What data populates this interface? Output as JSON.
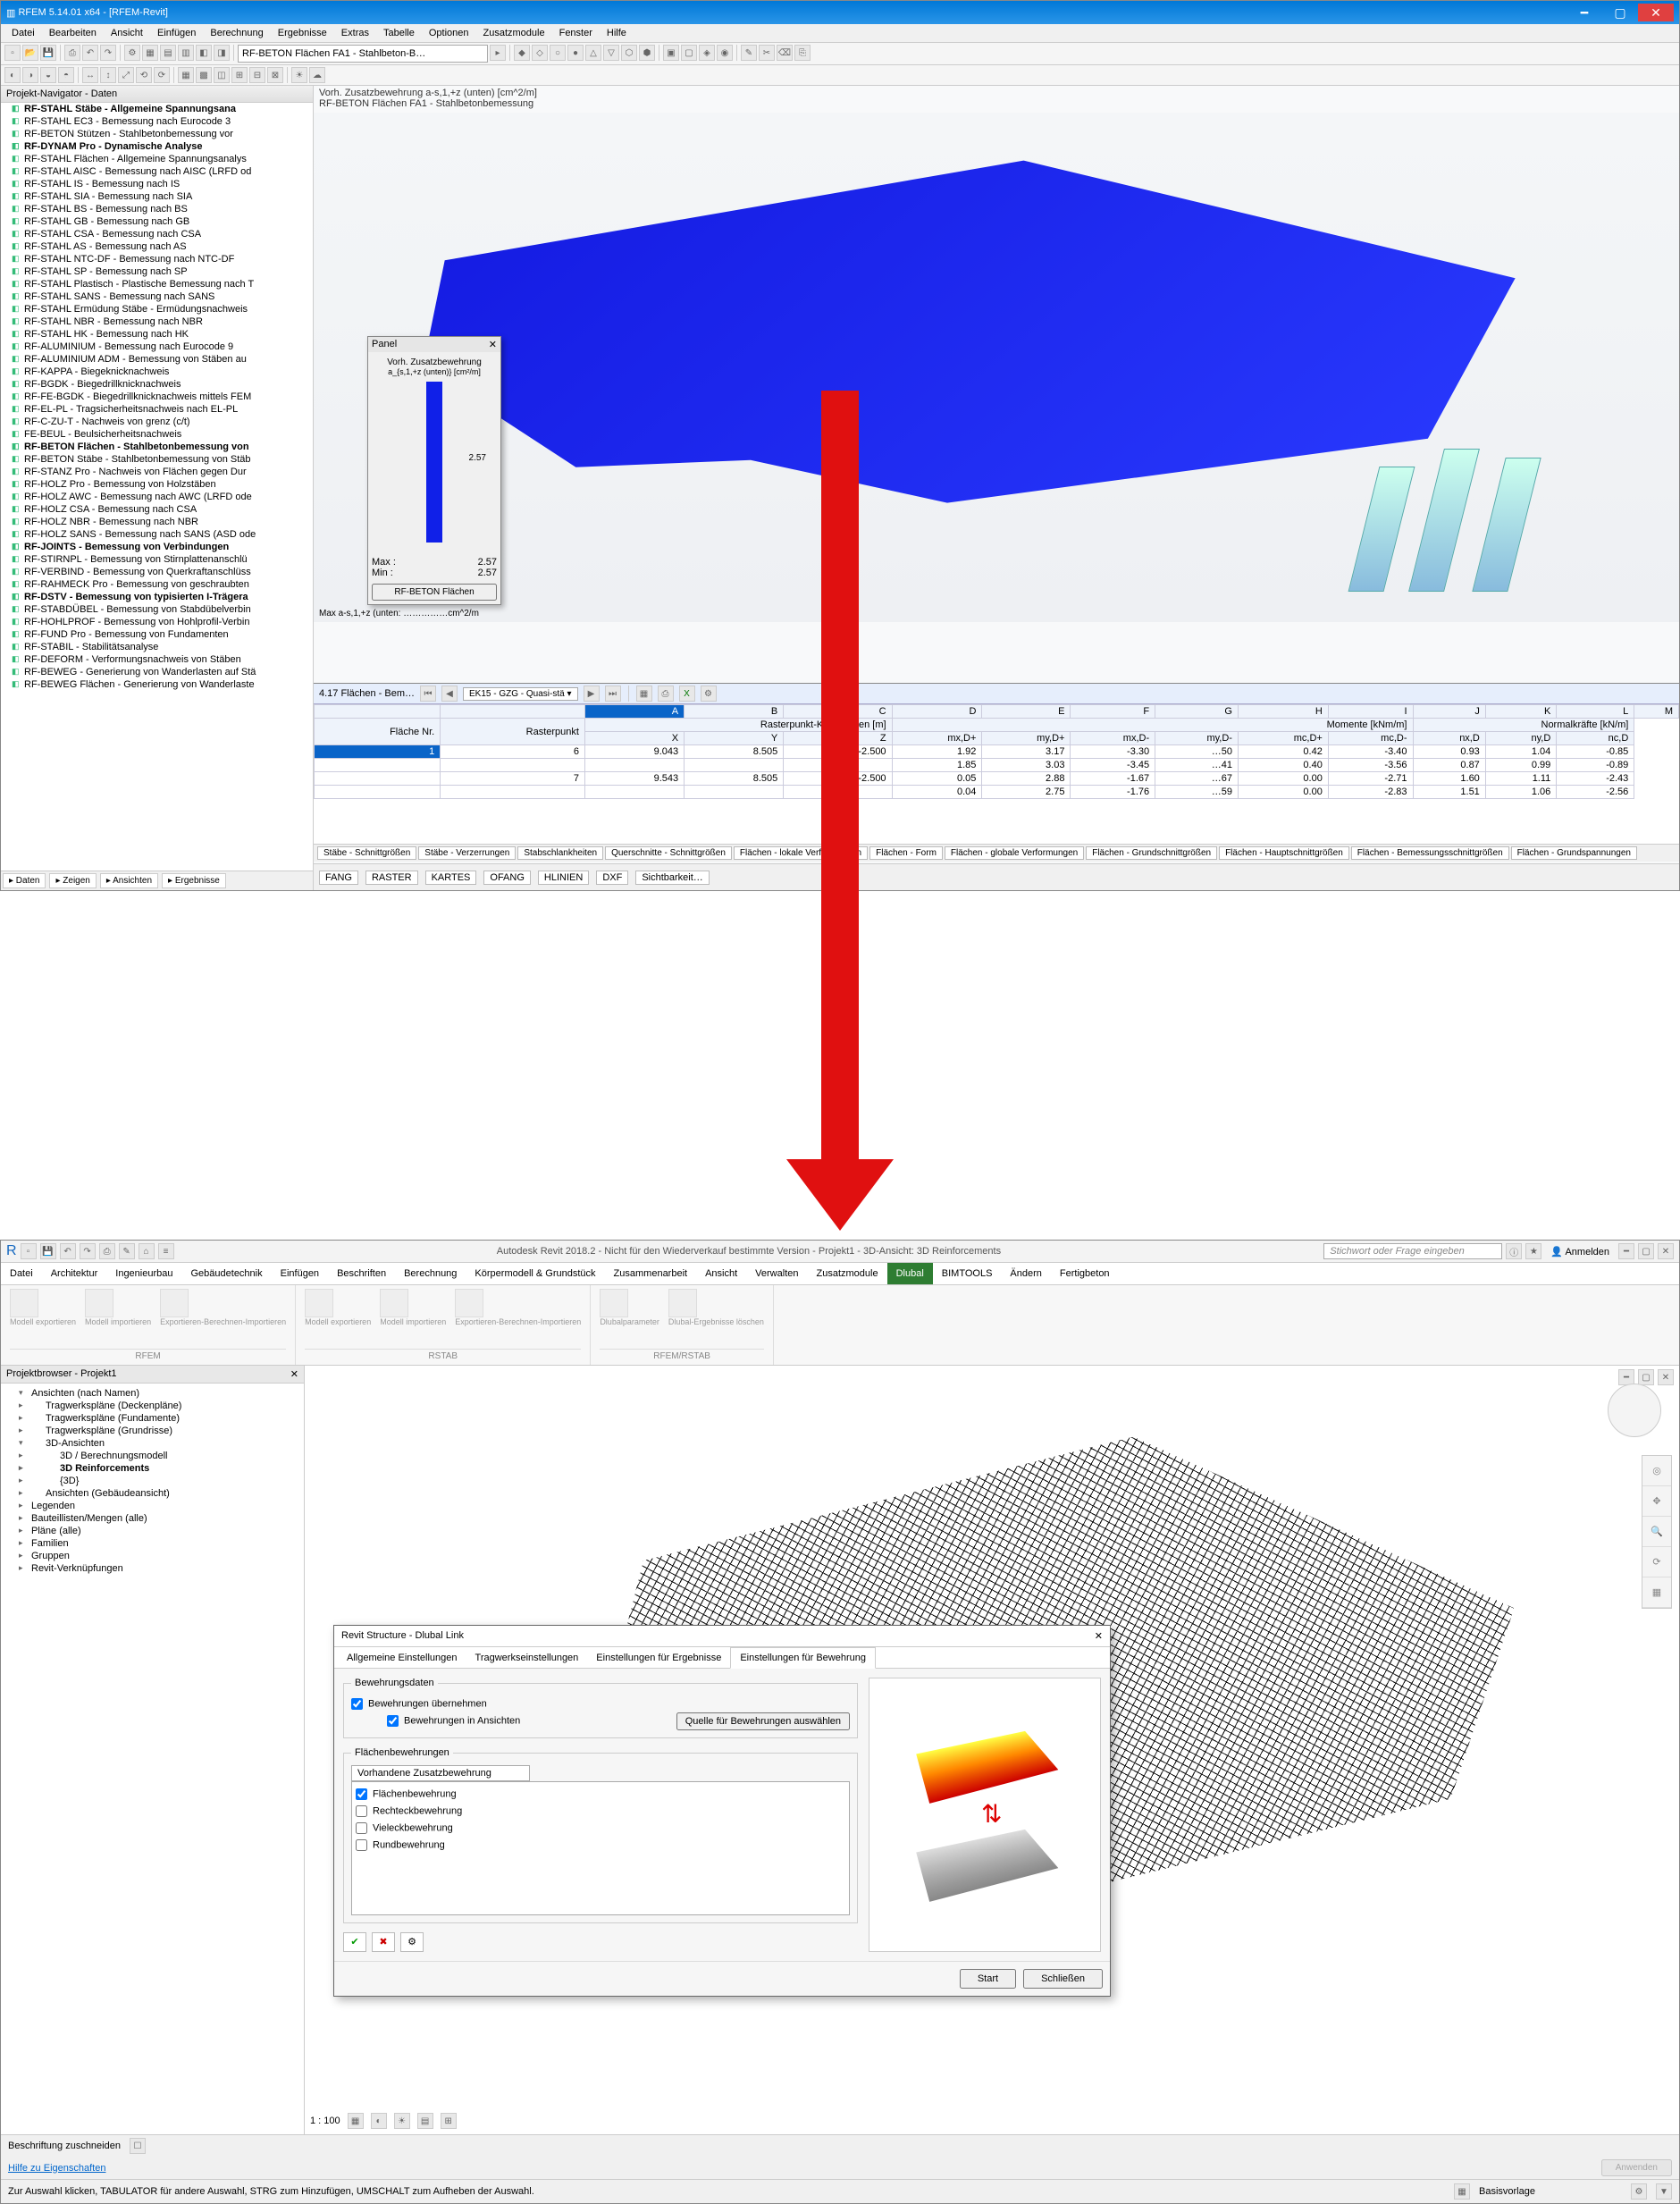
{
  "rfem": {
    "title": "RFEM 5.14.01 x64 - [RFEM-Revit]",
    "menu": [
      "Datei",
      "Bearbeiten",
      "Ansicht",
      "Einfügen",
      "Berechnung",
      "Ergebnisse",
      "Extras",
      "Tabelle",
      "Optionen",
      "Zusatzmodule",
      "Fenster",
      "Hilfe"
    ],
    "address": "RF-BETON Flächen FA1 - Stahlbeton-B…",
    "nav_title": "Projekt-Navigator - Daten",
    "nav_items": [
      {
        "label": "RF-STAHL Stäbe - Allgemeine Spannungsana",
        "bold": true
      },
      {
        "label": "RF-STAHL EC3 - Bemessung nach Eurocode 3"
      },
      {
        "label": "RF-BETON Stützen - Stahlbetonbemessung vor"
      },
      {
        "label": "RF-DYNAM Pro - Dynamische Analyse",
        "bold": true
      },
      {
        "label": "RF-STAHL Flächen - Allgemeine Spannungsanalys"
      },
      {
        "label": "RF-STAHL AISC - Bemessung nach AISC (LRFD od"
      },
      {
        "label": "RF-STAHL IS - Bemessung nach IS"
      },
      {
        "label": "RF-STAHL SIA - Bemessung nach SIA"
      },
      {
        "label": "RF-STAHL BS - Bemessung nach BS"
      },
      {
        "label": "RF-STAHL GB - Bemessung nach GB"
      },
      {
        "label": "RF-STAHL CSA - Bemessung nach CSA"
      },
      {
        "label": "RF-STAHL AS - Bemessung nach AS"
      },
      {
        "label": "RF-STAHL NTC-DF - Bemessung nach NTC-DF"
      },
      {
        "label": "RF-STAHL SP - Bemessung nach SP"
      },
      {
        "label": "RF-STAHL Plastisch - Plastische Bemessung nach T"
      },
      {
        "label": "RF-STAHL SANS - Bemessung nach SANS"
      },
      {
        "label": "RF-STAHL Ermüdung Stäbe - Ermüdungsnachweis"
      },
      {
        "label": "RF-STAHL NBR - Bemessung nach NBR"
      },
      {
        "label": "RF-STAHL HK - Bemessung nach HK"
      },
      {
        "label": "RF-ALUMINIUM - Bemessung nach Eurocode 9"
      },
      {
        "label": "RF-ALUMINIUM ADM - Bemessung von Stäben au"
      },
      {
        "label": "RF-KAPPA - Biegeknicknachweis"
      },
      {
        "label": "RF-BGDK - Biegedrillknicknachweis"
      },
      {
        "label": "RF-FE-BGDK - Biegedrillknicknachweis mittels FEM"
      },
      {
        "label": "RF-EL-PL - Tragsicherheitsnachweis nach EL-PL"
      },
      {
        "label": "RF-C-ZU-T - Nachweis von grenz (c/t)"
      },
      {
        "label": "FE-BEUL - Beulsicherheitsnachweis"
      },
      {
        "label": "RF-BETON Flächen - Stahlbetonbemessung von",
        "bold": true
      },
      {
        "label": "RF-BETON Stäbe - Stahlbetonbemessung von Stäb"
      },
      {
        "label": "RF-STANZ Pro - Nachweis von Flächen gegen Dur"
      },
      {
        "label": "RF-HOLZ Pro - Bemessung von Holzstäben"
      },
      {
        "label": "RF-HOLZ AWC - Bemessung nach AWC (LRFD ode"
      },
      {
        "label": "RF-HOLZ CSA - Bemessung nach CSA"
      },
      {
        "label": "RF-HOLZ NBR - Bemessung nach NBR"
      },
      {
        "label": "RF-HOLZ SANS - Bemessung nach SANS (ASD ode"
      },
      {
        "label": "RF-JOINTS - Bemessung von Verbindungen",
        "bold": true
      },
      {
        "label": "RF-STIRNPL - Bemessung von Stirnplattenanschlü"
      },
      {
        "label": "RF-VERBIND - Bemessung von Querkraftanschlüss"
      },
      {
        "label": "RF-RAHMECK Pro - Bemessung von geschraubten"
      },
      {
        "label": "RF-DSTV - Bemessung von typisierten I-Trägera",
        "bold": true
      },
      {
        "label": "RF-STABDÜBEL - Bemessung von Stabdübelverbin"
      },
      {
        "label": "RF-HOHLPROF - Bemessung von Hohlprofil-Verbin"
      },
      {
        "label": "RF-FUND Pro - Bemessung von Fundamenten"
      },
      {
        "label": "RF-STABIL - Stabilitätsanalyse"
      },
      {
        "label": "RF-DEFORM - Verformungsnachweis von Stäben"
      },
      {
        "label": "RF-BEWEG - Generierung von Wanderlasten auf Stä"
      },
      {
        "label": "RF-BEWEG Flächen - Generierung von Wanderlaste"
      }
    ],
    "nav_tabs": [
      "Daten",
      "Zeigen",
      "Ansichten",
      "Ergebnisse"
    ],
    "vp_line1": "Vorh. Zusatzbewehrung a-s,1,+z (unten) [cm^2/m]",
    "vp_line2": "RF-BETON Flächen FA1 - Stahlbetonbemessung",
    "panel": {
      "title": "Panel",
      "subtitle": "Vorh. Zusatzbewehrung",
      "unit": "a_{s,1,+z (unten)} [cm²/m]",
      "value": "2.57",
      "max": "2.57",
      "min": "2.57",
      "button": "RF-BETON Flächen"
    },
    "scene_label": "Max a-s,1,+z (unten: ……………cm^2/m",
    "table": {
      "title": "4.17 Flächen - Bem…",
      "combo": "EK15 - GZG - Quasi-stä ▾",
      "group_m": "Momente [kNm/m]",
      "group_n": "Normalkräfte [kN/m]",
      "group_r": "Rasterpunkt-Koordinaten [m]",
      "hdr": [
        "Fläche Nr.",
        "Rasterpunkt",
        "X",
        "Y",
        "Z",
        "mx,D+",
        "my,D+",
        "mx,D-",
        "my,D-",
        "mc,D+",
        "mc,D-",
        "nx,D",
        "ny,D",
        "nc,D"
      ],
      "cols": [
        "A",
        "B",
        "C",
        "D",
        "E",
        "F",
        "G",
        "H",
        "I",
        "J",
        "K",
        "L",
        "M"
      ],
      "rows": [
        [
          "1",
          "6",
          "9.043",
          "8.505",
          "-2.500",
          "1.92",
          "3.17",
          "-3.30",
          "…50",
          "0.42",
          "-3.40",
          "0.93",
          "1.04",
          "-0.85"
        ],
        [
          "",
          "",
          "",
          "",
          "",
          "1.85",
          "3.03",
          "-3.45",
          "…41",
          "0.40",
          "-3.56",
          "0.87",
          "0.99",
          "-0.89"
        ],
        [
          "",
          "7",
          "9.543",
          "8.505",
          "-2.500",
          "0.05",
          "2.88",
          "-1.67",
          "…67",
          "0.00",
          "-2.71",
          "1.60",
          "1.11",
          "-2.43"
        ],
        [
          "",
          "",
          "",
          "",
          "",
          "0.04",
          "2.75",
          "-1.76",
          "…59",
          "0.00",
          "-2.83",
          "1.51",
          "1.06",
          "-2.56"
        ]
      ],
      "bottom_tabs": [
        "Stäbe - Schnittgrößen",
        "Stäbe - Verzerrungen",
        "Stabschlankheiten",
        "Querschnitte - Schnittgrößen",
        "Flächen - lokale Verformungen",
        "Flächen - Form",
        "Flächen - globale Verformungen",
        "Flächen - Grundschnittgrößen",
        "Flächen - Hauptschnittgrößen",
        "Flächen - Bemessungsschnittgrößen",
        "Flächen - Grundspannungen"
      ]
    },
    "status_tabs": [
      "FANG",
      "RASTER",
      "KARTES",
      "OFANG",
      "HLINIEN",
      "DXF",
      "Sichtbarkeit…"
    ]
  },
  "revit": {
    "title_center": "Autodesk Revit 2018.2 - Nicht für den Wiederverkauf bestimmte Version -   Projekt1 - 3D-Ansicht: 3D Reinforcements",
    "search_placeholder": "Stichwort oder Frage eingeben",
    "signin": "Anmelden",
    "tabs": [
      "Datei",
      "Architektur",
      "Ingenieurbau",
      "Gebäudetechnik",
      "Einfügen",
      "Beschriften",
      "Berechnung",
      "Körpermodell & Grundstück",
      "Zusammenarbeit",
      "Ansicht",
      "Verwalten",
      "Zusatzmodule",
      "Dlubal",
      "BIMTOOLS",
      "Ändern",
      "Fertigbeton"
    ],
    "ribbon": {
      "g1_items": [
        "Modell exportieren",
        "Modell importieren",
        "Exportieren-Berechnen-Importieren"
      ],
      "g1_label": "RFEM",
      "g2_items": [
        "Modell exportieren",
        "Modell importieren",
        "Exportieren-Berechnen-Importieren"
      ],
      "g2_label": "RSTAB",
      "g3_items": [
        "Dlubalparameter",
        "Dlubal-Ergebnisse löschen"
      ],
      "g3_label": "RFEM/RSTAB"
    },
    "browser": {
      "title": "Projektbrowser - Projekt1",
      "items": [
        {
          "label": "Ansichten (nach Namen)",
          "lvl": 1,
          "open": true
        },
        {
          "label": "Tragwerkspläne (Deckenpläne)",
          "lvl": 2
        },
        {
          "label": "Tragwerkspläne (Fundamente)",
          "lvl": 2
        },
        {
          "label": "Tragwerkspläne (Grundrisse)",
          "lvl": 2
        },
        {
          "label": "3D-Ansichten",
          "lvl": 2,
          "open": true
        },
        {
          "label": "3D / Berechnungsmodell",
          "lvl": 3
        },
        {
          "label": "3D Reinforcements",
          "lvl": 3,
          "bold": true
        },
        {
          "label": "{3D}",
          "lvl": 3
        },
        {
          "label": "Ansichten (Gebäudeansicht)",
          "lvl": 2
        },
        {
          "label": "Legenden",
          "lvl": 1
        },
        {
          "label": "Bauteillisten/Mengen (alle)",
          "lvl": 1
        },
        {
          "label": "Pläne (alle)",
          "lvl": 1
        },
        {
          "label": "Familien",
          "lvl": 1
        },
        {
          "label": "Gruppen",
          "lvl": 1
        },
        {
          "label": "Revit-Verknüpfungen",
          "lvl": 1
        }
      ]
    },
    "dialog": {
      "title": "Revit Structure - Dlubal Link",
      "tabs": [
        "Allgemeine Einstellungen",
        "Tragwerkseinstellungen",
        "Einstellungen für Ergebnisse",
        "Einstellungen für Bewehrung"
      ],
      "active_tab": 3,
      "fs1": "Bewehrungsdaten",
      "chk1": "Bewehrungen übernehmen",
      "chk2": "Bewehrungen in Ansichten",
      "btn_source": "Quelle für Bewehrungen auswählen",
      "fs2": "Flächenbewehrungen",
      "combo": "Vorhandene Zusatzbewehrung",
      "opts": [
        "Flächenbewehrung",
        "Rechteckbewehrung",
        "Vieleckbewehrung",
        "Rundbewehrung"
      ],
      "start": "Start",
      "close": "Schließen"
    },
    "props_help": "Hilfe zu Eigenschaften",
    "props_apply": "Anwenden",
    "props_cut": "Beschriftung zuschneiden",
    "status_scale": "1 : 100",
    "status_basis": "Basisvorlage",
    "status": "Zur Auswahl klicken, TABULATOR für andere Auswahl, STRG zum Hinzufügen, UMSCHALT zum Aufheben der Auswahl."
  }
}
